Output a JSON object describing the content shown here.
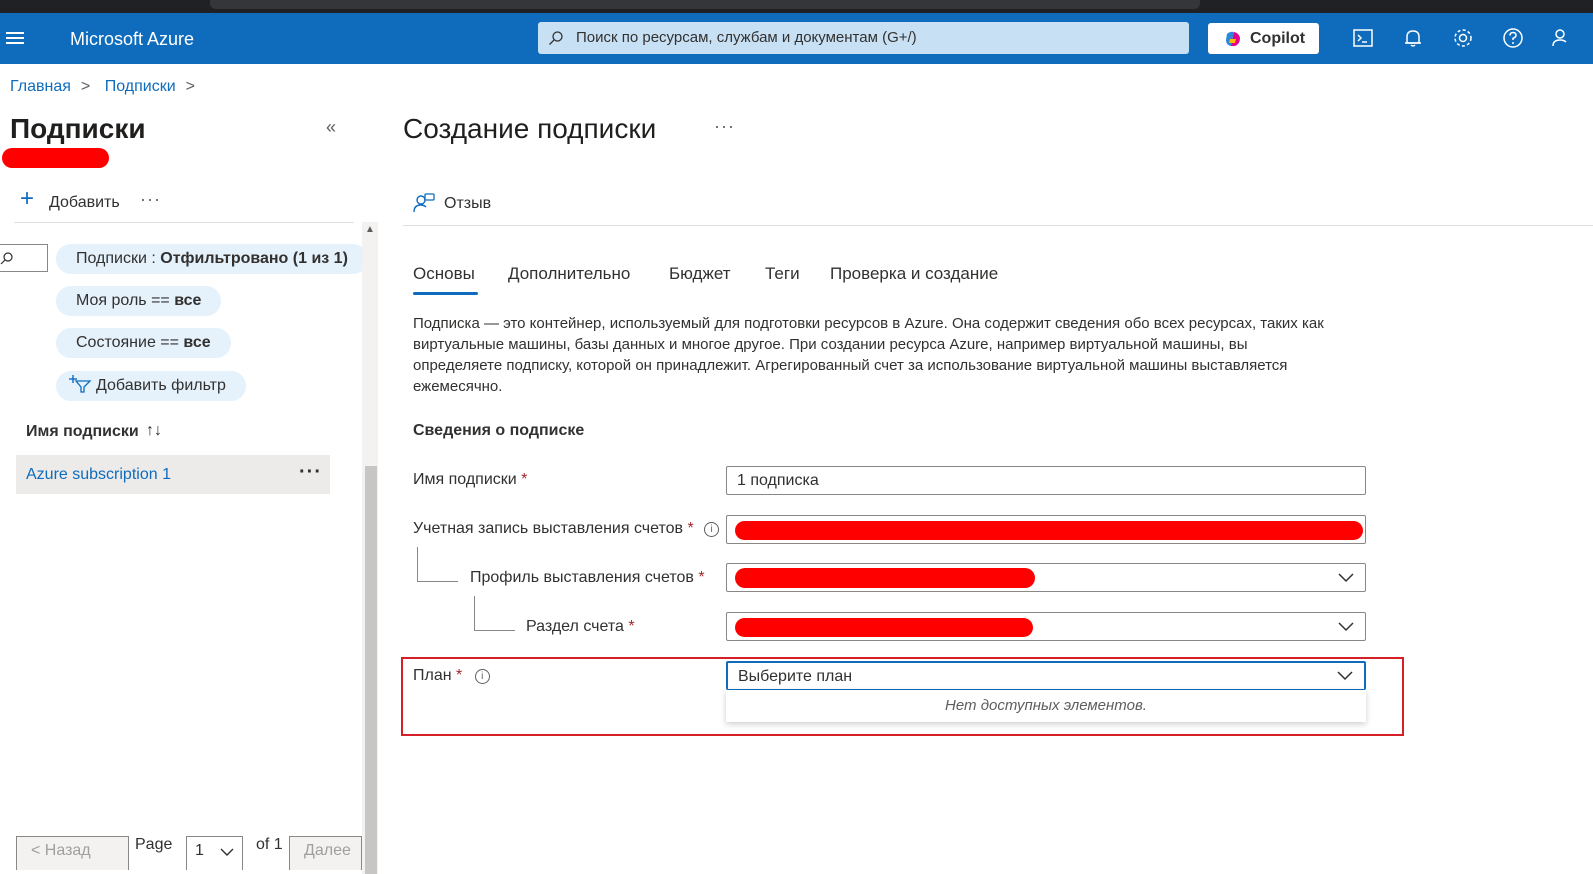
{
  "topbar": {
    "brand": "Microsoft Azure",
    "search_placeholder": "Поиск по ресурсам, службам и документам (G+/)",
    "copilot_label": "Copilot"
  },
  "breadcrumb": {
    "items": [
      "Главная",
      "Подписки"
    ]
  },
  "left_panel": {
    "title": "Подписки",
    "add_label": "Добавить",
    "filters": {
      "subscriptions_prefix": "Подписки : ",
      "subscriptions_value": "Отфильтровано (1 из 1)",
      "role_prefix": "Моя роль == ",
      "role_value": "все",
      "state_prefix": "Состояние == ",
      "state_value": "все",
      "add_filter": "Добавить фильтр"
    },
    "column_header": "Имя подписки",
    "rows": [
      {
        "name": "Azure subscription 1"
      }
    ],
    "pager": {
      "prev": "< Назад",
      "page_label": "Page",
      "page_value": "1",
      "of_label": "of 1",
      "next": "Далее"
    }
  },
  "form": {
    "title": "Создание подписки",
    "feedback": "Отзыв",
    "tabs": [
      "Основы",
      "Дополнительно",
      "Бюджет",
      "Теги",
      "Проверка и создание"
    ],
    "description": "Подписка — это контейнер, используемый для подготовки ресурсов в Azure. Она содержит сведения обо всех ресурсах, таких как виртуальные машины, базы данных и многое другое. При создании ресурса Azure, например виртуальной машины, вы определяете подписку, которой он принадлежит. Агрегированный счет за использование виртуальной машины выставляется ежемесячно.",
    "section_title": "Сведения о подписке",
    "fields": {
      "name_label": "Имя подписки",
      "name_value": "1 подписка",
      "billing_account_label": "Учетная запись выставления счетов",
      "billing_profile_label": "Профиль выставления счетов",
      "invoice_section_label": "Раздел счета",
      "plan_label": "План",
      "plan_placeholder": "Выберите план",
      "plan_empty": "Нет доступных элементов."
    },
    "required_marker": "*"
  },
  "colors": {
    "accent": "#0f6cbd",
    "highlight_border": "#d61f26",
    "redaction": "#ff0000"
  }
}
